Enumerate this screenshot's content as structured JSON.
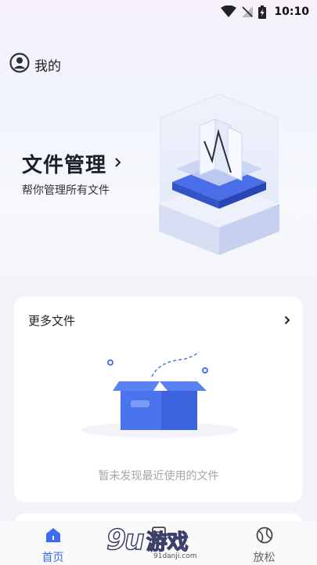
{
  "status_bar": {
    "time": "10:10"
  },
  "profile": {
    "label": "我的"
  },
  "hero": {
    "title": "文件管理",
    "subtitle": "帮你管理所有文件"
  },
  "recent_card": {
    "title": "更多文件",
    "empty_message": "暂未发现最近使用的文件"
  },
  "bottom_nav": [
    {
      "label": "首页",
      "icon": "home-icon",
      "active": true
    },
    {
      "label": "",
      "icon": "document-icon",
      "active": false
    },
    {
      "label": "放松",
      "icon": "ball-icon",
      "active": false
    }
  ],
  "watermark": {
    "number": "9u",
    "text": "游戏",
    "url": "91danji.com"
  },
  "colors": {
    "accent": "#3d6cf0",
    "box_blue": "#4a74ee"
  }
}
